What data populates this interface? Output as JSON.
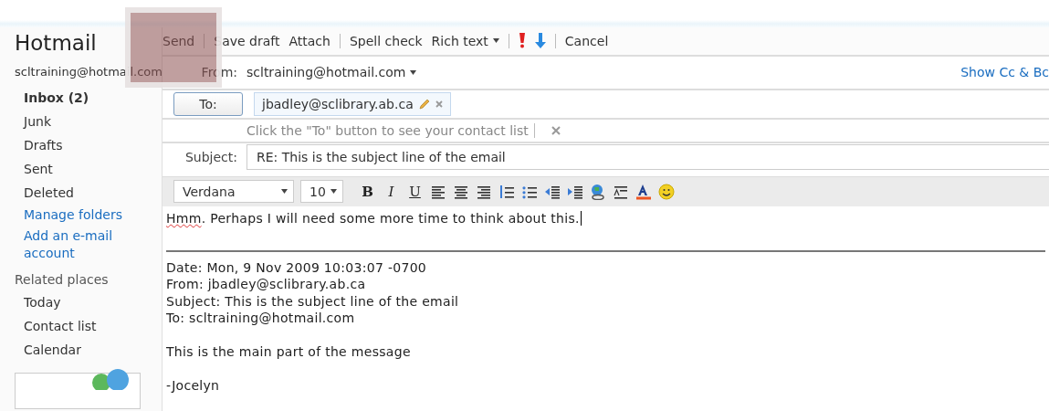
{
  "sidebar": {
    "brand": "Hotmail",
    "account": "scltraining@hotmail.com",
    "folders": [
      {
        "label": "Inbox (2)",
        "unread": true
      },
      {
        "label": "Junk",
        "unread": false
      },
      {
        "label": "Drafts",
        "unread": false
      },
      {
        "label": "Sent",
        "unread": false
      },
      {
        "label": "Deleted",
        "unread": false
      }
    ],
    "links": [
      "Manage folders",
      "Add an e-mail account"
    ],
    "related_heading": "Related places",
    "related": [
      "Today",
      "Contact list",
      "Calendar"
    ]
  },
  "toolbar": [
    {
      "kind": "button",
      "label": "Send"
    },
    {
      "kind": "separator"
    },
    {
      "kind": "button",
      "label": "Save draft"
    },
    {
      "kind": "button",
      "label": "Attach"
    },
    {
      "kind": "separator"
    },
    {
      "kind": "button",
      "label": "Spell check"
    },
    {
      "kind": "dropdown",
      "label": "Rich text"
    },
    {
      "kind": "separator"
    },
    {
      "kind": "priority-high"
    },
    {
      "kind": "priority-low"
    },
    {
      "kind": "separator"
    },
    {
      "kind": "button",
      "label": "Cancel"
    }
  ],
  "compose": {
    "from_label": "From:",
    "from": "scltraining@hotmail.com",
    "show_cc": "Show Cc & Bc",
    "to_button": "To:",
    "recipients": [
      "jbadley@sclibrary.ab.ca"
    ],
    "hint": "Click the \"To\" button to see your contact list",
    "subject_label": "Subject:",
    "subject": "RE: This is the subject line of the email"
  },
  "format": {
    "font": "Verdana",
    "size": "10",
    "buttons": [
      {
        "kind": "bold",
        "label": "B"
      },
      {
        "kind": "italic",
        "label": "I"
      },
      {
        "kind": "underline",
        "label": "U"
      },
      {
        "kind": "align-left"
      },
      {
        "kind": "align-center"
      },
      {
        "kind": "align-right"
      },
      {
        "kind": "numbered-list"
      },
      {
        "kind": "bullet-list"
      },
      {
        "kind": "outdent"
      },
      {
        "kind": "indent"
      },
      {
        "kind": "link"
      },
      {
        "kind": "style"
      },
      {
        "kind": "font-color"
      },
      {
        "kind": "emoticon"
      }
    ]
  },
  "body": {
    "reply": [
      {
        "text": "Hmm",
        "misspelled": true
      },
      {
        "text": ". Perhaps I will need some more time to think about this.",
        "misspelled": false
      }
    ],
    "quoted": [
      [
        "Date: Mon, 9 Nov 2009 10:03:07 -0700",
        "From: jbadley@sclibrary.ab.ca",
        "Subject: This is the subject line of the email",
        "To: scltraining@hotmail.com"
      ],
      [
        "This is the main part of the message"
      ],
      [
        "-Jocelyn"
      ]
    ]
  }
}
